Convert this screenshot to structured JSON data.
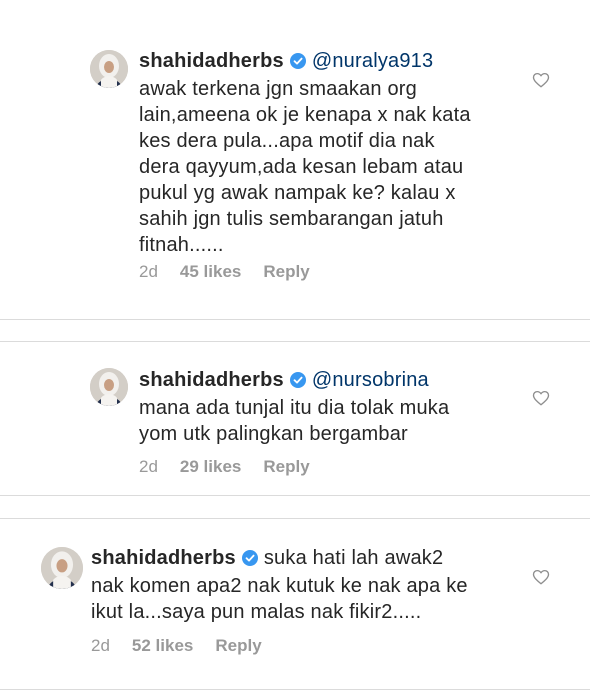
{
  "comments": [
    {
      "username": "shahidadherbs",
      "mention": "@nuralya913",
      "lines": [
        "awak terkena jgn smaakan org",
        "lain,ameena ok je kenapa x nak kata",
        "kes dera pula...apa motif dia nak",
        "dera qayyum,ada kesan lebam atau",
        "pukul yg awak nampak ke? kalau x",
        "sahih jgn tulis sembarangan jatuh",
        "fitnah......"
      ],
      "time": "2d",
      "likes": "45 likes",
      "reply": "Reply"
    },
    {
      "username": "shahidadherbs",
      "mention": "@nursobrina",
      "lines": [
        "mana ada tunjal itu dia tolak muka",
        "yom utk palingkan bergambar"
      ],
      "time": "2d",
      "likes": "29 likes",
      "reply": "Reply"
    },
    {
      "username": "shahidadherbs",
      "first_line_text": "suka hati lah awak2",
      "lines": [
        "nak komen apa2 nak kutuk ke nak apa ke",
        "ikut la...saya pun malas nak fikir2....."
      ],
      "time": "2d",
      "likes": "52 likes",
      "reply": "Reply"
    }
  ],
  "icons": {
    "verified": "verified-badge-icon",
    "like": "heart-outline-icon"
  },
  "colors": {
    "text": "#262626",
    "mention": "#003569",
    "meta": "#999999",
    "verified_blue": "#3897f0",
    "border": "#dbdbdb"
  }
}
